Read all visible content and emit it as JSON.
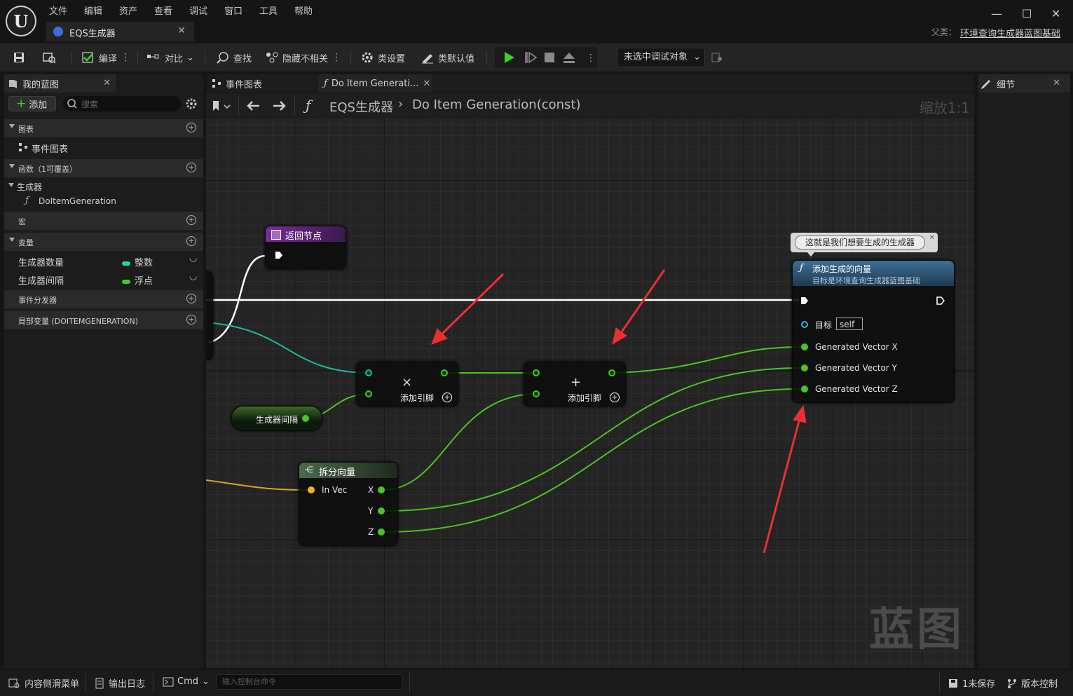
{
  "window": {
    "menu": [
      "文件",
      "编辑",
      "资产",
      "查看",
      "调试",
      "窗口",
      "工具",
      "帮助"
    ],
    "doc_tab": "EQS生成器",
    "parent_label": "父类：",
    "parent_value": "环境查询生成器蓝图基础",
    "controls": {
      "minimize": "—",
      "maximize": "☐",
      "close": "✕"
    }
  },
  "toolbar": {
    "compile": "编译",
    "diff": "对比",
    "find": "查找",
    "hide_unrelated": "隐藏不相关",
    "class_settings": "类设置",
    "class_defaults": "类默认值",
    "debug_target": "未选中调试对象"
  },
  "my_blueprint": {
    "tab": "我的蓝图",
    "add": "添加",
    "search_placeholder": "搜索",
    "graphs_header": "图表",
    "event_graph": "事件图表",
    "functions_header": "函数（1可覆盖）",
    "generator_group": "生成器",
    "function_item": "DoItemGeneration",
    "macros_header": "宏",
    "variables_header": "变量",
    "variables": [
      {
        "name": "生成器数量",
        "type": "整数",
        "color": "#1fd8a8"
      },
      {
        "name": "生成器间隔",
        "type": "浮点",
        "color": "#38d12e"
      }
    ],
    "dispatchers_header": "事件分发器",
    "locals_header": "局部变量 (DOITEMGENERATION)"
  },
  "graph": {
    "tabs": [
      "事件图表",
      "Do Item Generati..."
    ],
    "breadcrumb_root": "EQS生成器",
    "breadcrumb_leaf": "Do Item Generation(const)",
    "zoom": "缩放1:1",
    "watermark": "蓝图",
    "nodes": {
      "return": "返回节点",
      "var_get": "生成器间隔",
      "multiply_symbol": "×",
      "add_symbol": "+",
      "add_pin": "添加引脚",
      "break_vector": "拆分向量",
      "in_vec": "In Vec",
      "out_x": "X",
      "out_y": "Y",
      "out_z": "Z",
      "comment": "这就是我们想要生成的生成器",
      "func_title": "添加生成的向量",
      "func_subtitle": "目标是环境查询生成器蓝图基础",
      "target_label": "目标",
      "target_value": "self",
      "gen_x": "Generated Vector X",
      "gen_y": "Generated Vector Y",
      "gen_z": "Generated Vector Z"
    }
  },
  "details": {
    "tab": "细节"
  },
  "statusbar": {
    "content_drawer": "内容侧滑菜单",
    "output_log": "输出日志",
    "cmd": "Cmd",
    "cmd_placeholder": "输入控制台命令",
    "unsaved": "1未保存",
    "source_control": "版本控制"
  },
  "colors": {
    "float_wire": "#48c520",
    "int_wire": "#1fb89a",
    "vector_wire": "#d8a626",
    "annotation": "#e83030"
  }
}
